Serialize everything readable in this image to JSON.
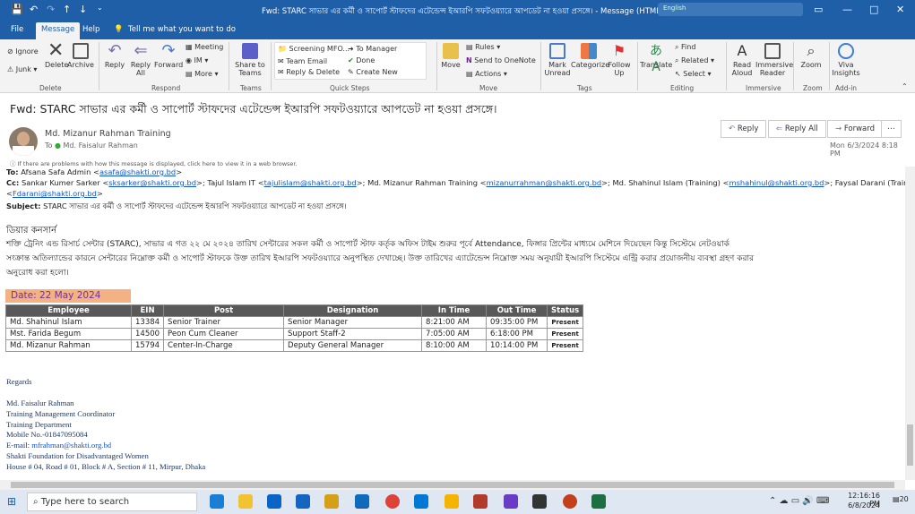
{
  "titlebar": {
    "title": "Fwd: STARC সাভার এর কর্মী ও সাপোর্ট স্টাফদের এটেন্ডেন্স ইআরপি সফটওয়্যারে আপডেট না হওয়া প্রসঙ্গে। - Message (HTML)",
    "search_placeholder": "English"
  },
  "menu": {
    "file": "File",
    "message": "Message",
    "help": "Help",
    "tell": "Tell me what you want to do"
  },
  "ribbon": {
    "ignore": "Ignore",
    "junk": "Junk",
    "delete": "Delete",
    "archive": "Archive",
    "reply": "Reply",
    "reply_all": "Reply All",
    "forward": "Forward",
    "meeting": "Meeting",
    "im": "IM",
    "more": "More",
    "share": "Share to Teams",
    "screening": "Screening MFO...",
    "team_email": "Team Email",
    "reply_delete": "Reply & Delete",
    "to_manager": "To Manager",
    "done": "Done",
    "create_new": "Create New",
    "rules": "Rules",
    "onenote": "Send to OneNote",
    "actions": "Actions",
    "move": "Move",
    "mark_unread": "Mark Unread",
    "categorize": "Categorize",
    "follow_up": "Follow Up",
    "translate": "Translate",
    "find": "Find",
    "related": "Related",
    "select": "Select",
    "read_aloud": "Read Aloud",
    "immersive": "Immersive Reader",
    "zoom": "Zoom",
    "viva": "Viva Insights",
    "groups": {
      "delete": "Delete",
      "respond": "Respond",
      "teams": "Teams",
      "quick_steps": "Quick Steps",
      "move": "Move",
      "tags": "Tags",
      "editing": "Editing",
      "immersive": "Immersive",
      "zoom": "Zoom",
      "addin": "Add-in"
    }
  },
  "message": {
    "subject": "Fwd: STARC সাভার এর কর্মী ও সাপোর্ট স্টাফদের এটেন্ডেন্স ইআরপি সফটওয়্যারে আপডেট না হওয়া প্রসঙ্গে।",
    "sender": "Md. Mizanur Rahman Training",
    "to_label": "To",
    "to_name": "Md. Faisalur Rahman",
    "reply": "Reply",
    "reply_all": "Reply All",
    "forward": "Forward",
    "date": "Mon 6/3/2024 8:18 PM",
    "info": "If there are problems with how this message is displayed, click here to view it in a web browser.",
    "to_line_label": "To:",
    "to_line_name": "Afsana Safa Admin <",
    "to_line_email": "asafa@shakti.org.bd",
    "to_line_end": ">",
    "cc_label": "Cc:",
    "cc_1_name": "Sankar Kumer Sarker <",
    "cc_1_email": "sksarker@shakti.org.bd",
    "cc_2_name": ">; Tajul Islam IT <",
    "cc_2_email": "tajulislam@shakti.org.bd",
    "cc_3_name": ">; Md. Mizanur Rahman Training <",
    "cc_3_email": "mizanurrahman@shakti.org.bd",
    "cc_4_name": ">; Md. Shahinul Islam (Training) <",
    "cc_4_email": "mshahinul@shakti.org.bd",
    "cc_5_name": ">; Faysal Darani (Training)",
    "cc_5_open": "<",
    "cc_5_email": "Fdarani@shakti.org.bd",
    "cc_5_end": ">",
    "subject_label": "Subject:",
    "subject_text": "STARC সাভার এর কর্মী ও সাপোর্ট স্টাফদের এটেন্ডেন্স ইআরপি সফটওয়্যারে আপডেট না হওয়া প্রসঙ্গে।",
    "greeting": "ডিয়ার কনসার্ন",
    "para1": "শক্তি ট্রেনিং এন্ড রিসার্চ সেন্টার (STARC), সাভার এ গত ২২ মে ২০২৪ তারিখ সেন্টারের সকল কর্মী ও সাপোর্ট স্টাফ কর্তৃক অফিস টাইম শুরুর পূর্বে Attendance, ফিঙ্গার প্রিন্টের মাধ্যমে মেশিনে দিয়েছেন কিন্তু সিস্টেমে নেটওয়ার্ক",
    "para2": "সংক্রান্ত অতিল্যান্ডের কারনে সেন্টারের নিম্নোক্ত কর্মী ও সাপোর্ট স্টাফকে উক্ত তারিখ ইআরপি সফটওয়্যারে অনুপস্থিত দেখাচ্ছে। উক্ত তারিখের এ্যাটেন্ডেন্স নিম্নোক্ত সময় অনুযায়ী ইআরপি সিস্টেমে এন্ট্রি করার প্রয়োজনীয় ব্যবস্থা গ্রহণ করার",
    "para3": "অনুরোধ করা হলো।",
    "date_box": "Date: 22 May 2024"
  },
  "table": {
    "headers": [
      "Employee",
      "EIN",
      "Post",
      "Designation",
      "In Time",
      "Out Time",
      "Status"
    ],
    "rows": [
      [
        "Md. Shahinul Islam",
        "13384",
        "Senior Trainer",
        "Senior Manager",
        "8:21:00 AM",
        "09:35:00 PM",
        "Present"
      ],
      [
        "Mst. Farida Begum",
        "14500",
        "Peon Cum Cleaner",
        "Support Staff-2",
        "7:05:00 AM",
        "6:18:00 PM",
        "Present"
      ],
      [
        "Md. Mizanur Rahman",
        "15794",
        "Center-In-Charge",
        "Deputy General Manager",
        "8:10:00 AM",
        "10:14:00 PM",
        "Present"
      ]
    ]
  },
  "signature": {
    "regards": "Regards",
    "name": "Md. Faisalur Rahman",
    "title": "Training Management Coordinator",
    "dept": "Training Department",
    "mobile": "Mobile No.-01847095084",
    "email_label": "E-mail: ",
    "email": "mfrahman@shakti.org.bd",
    "org": "Shakti Foundation for Disadvantaged Women",
    "address": "House # 04, Road # 01, Block # A, Section # 11, Mirpur, Dhaka"
  },
  "taskbar": {
    "search": "Type here to search",
    "time": "12:16:16 PM",
    "date": "6/8/2024",
    "notif": "20"
  }
}
